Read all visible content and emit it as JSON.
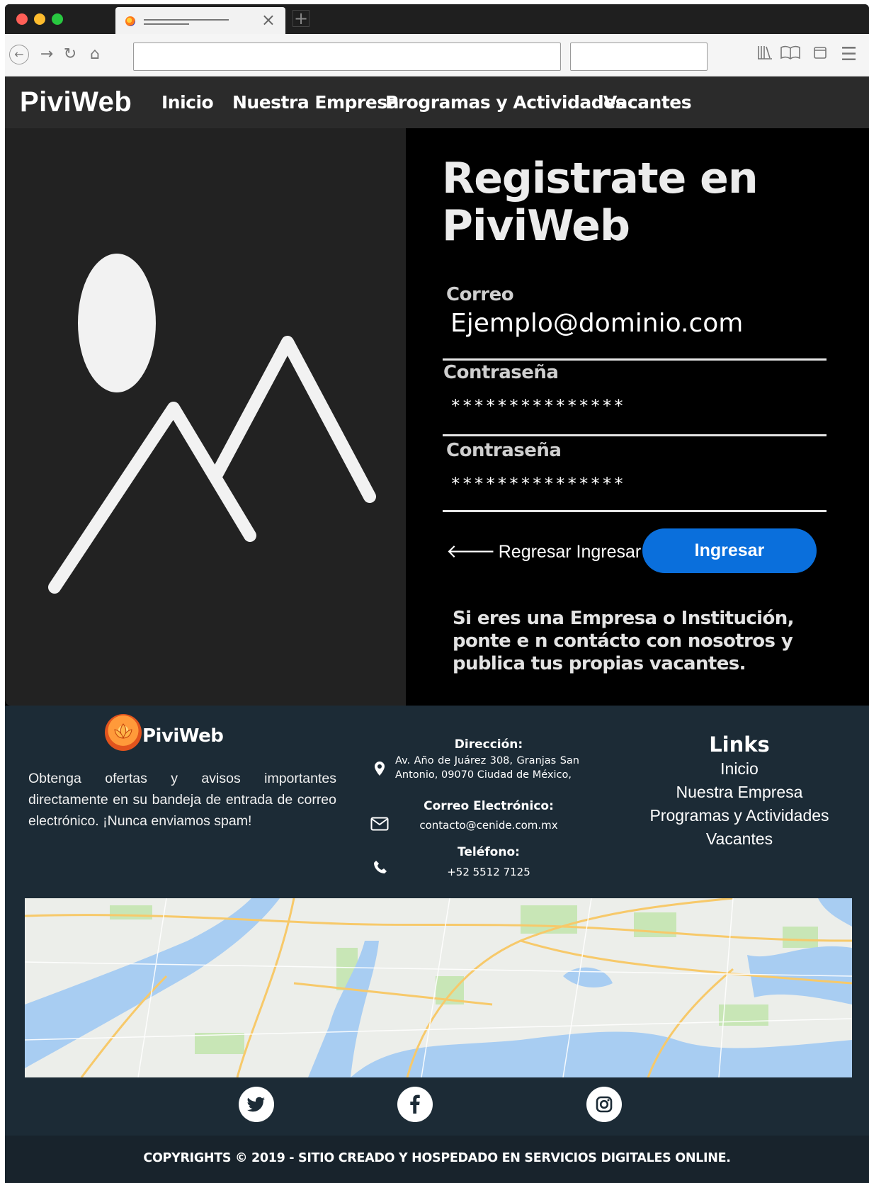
{
  "browser": {
    "tab_close": "×",
    "new_tab": "+"
  },
  "site": {
    "brand": "PiviWeb",
    "nav": [
      "Inicio",
      "Nuestra Empresa",
      "Programas y Actividades",
      "Vacantes"
    ]
  },
  "register": {
    "title": "Registrate en PiviWeb",
    "fields": [
      {
        "label": "Correo",
        "value": "Ejemplo@dominio.com"
      },
      {
        "label": "Contraseña",
        "value": "***************"
      },
      {
        "label": "Contraseña",
        "value": "***************"
      }
    ],
    "back_label": "Regresar Ingresar",
    "submit_label": "Ingresar",
    "promo": "Si eres una Empresa o Institución, ponte e n contácto con nosotros y  publica tus propias vacantes."
  },
  "footer": {
    "brand": "PiviWeb",
    "blurb": "Obtenga ofertas y avisos importantes directamente en su bandeja de entrada de correo electrónico. ¡Nunca enviamos spam!",
    "address_heading": "Dirección:",
    "address": "Av. Año de Juárez 308, Granjas San Antonio, 09070 Ciudad de México,",
    "email_heading": "Correo Electrónico:",
    "email": "contacto@cenide.com.mx",
    "phone_heading": "Teléfono:",
    "phone": "+52 5512 7125",
    "links_heading": "Links",
    "links": [
      "Inicio",
      "Nuestra Empresa",
      "Programas y Actividades",
      "Vacantes"
    ],
    "social": [
      {
        "icon": "twitter-icon"
      },
      {
        "icon": "facebook-icon"
      },
      {
        "icon": "instagram-icon"
      }
    ],
    "copyright": "COPYRIGHTS © 2019 - SITIO CREADO Y HOSPEDADO EN SERVICIOS DIGITALES ONLINE."
  },
  "colors": {
    "nav_bg": "#2b2b2b",
    "primary_button": "#0a6fdc",
    "footer_bg": "#1c2b36"
  }
}
